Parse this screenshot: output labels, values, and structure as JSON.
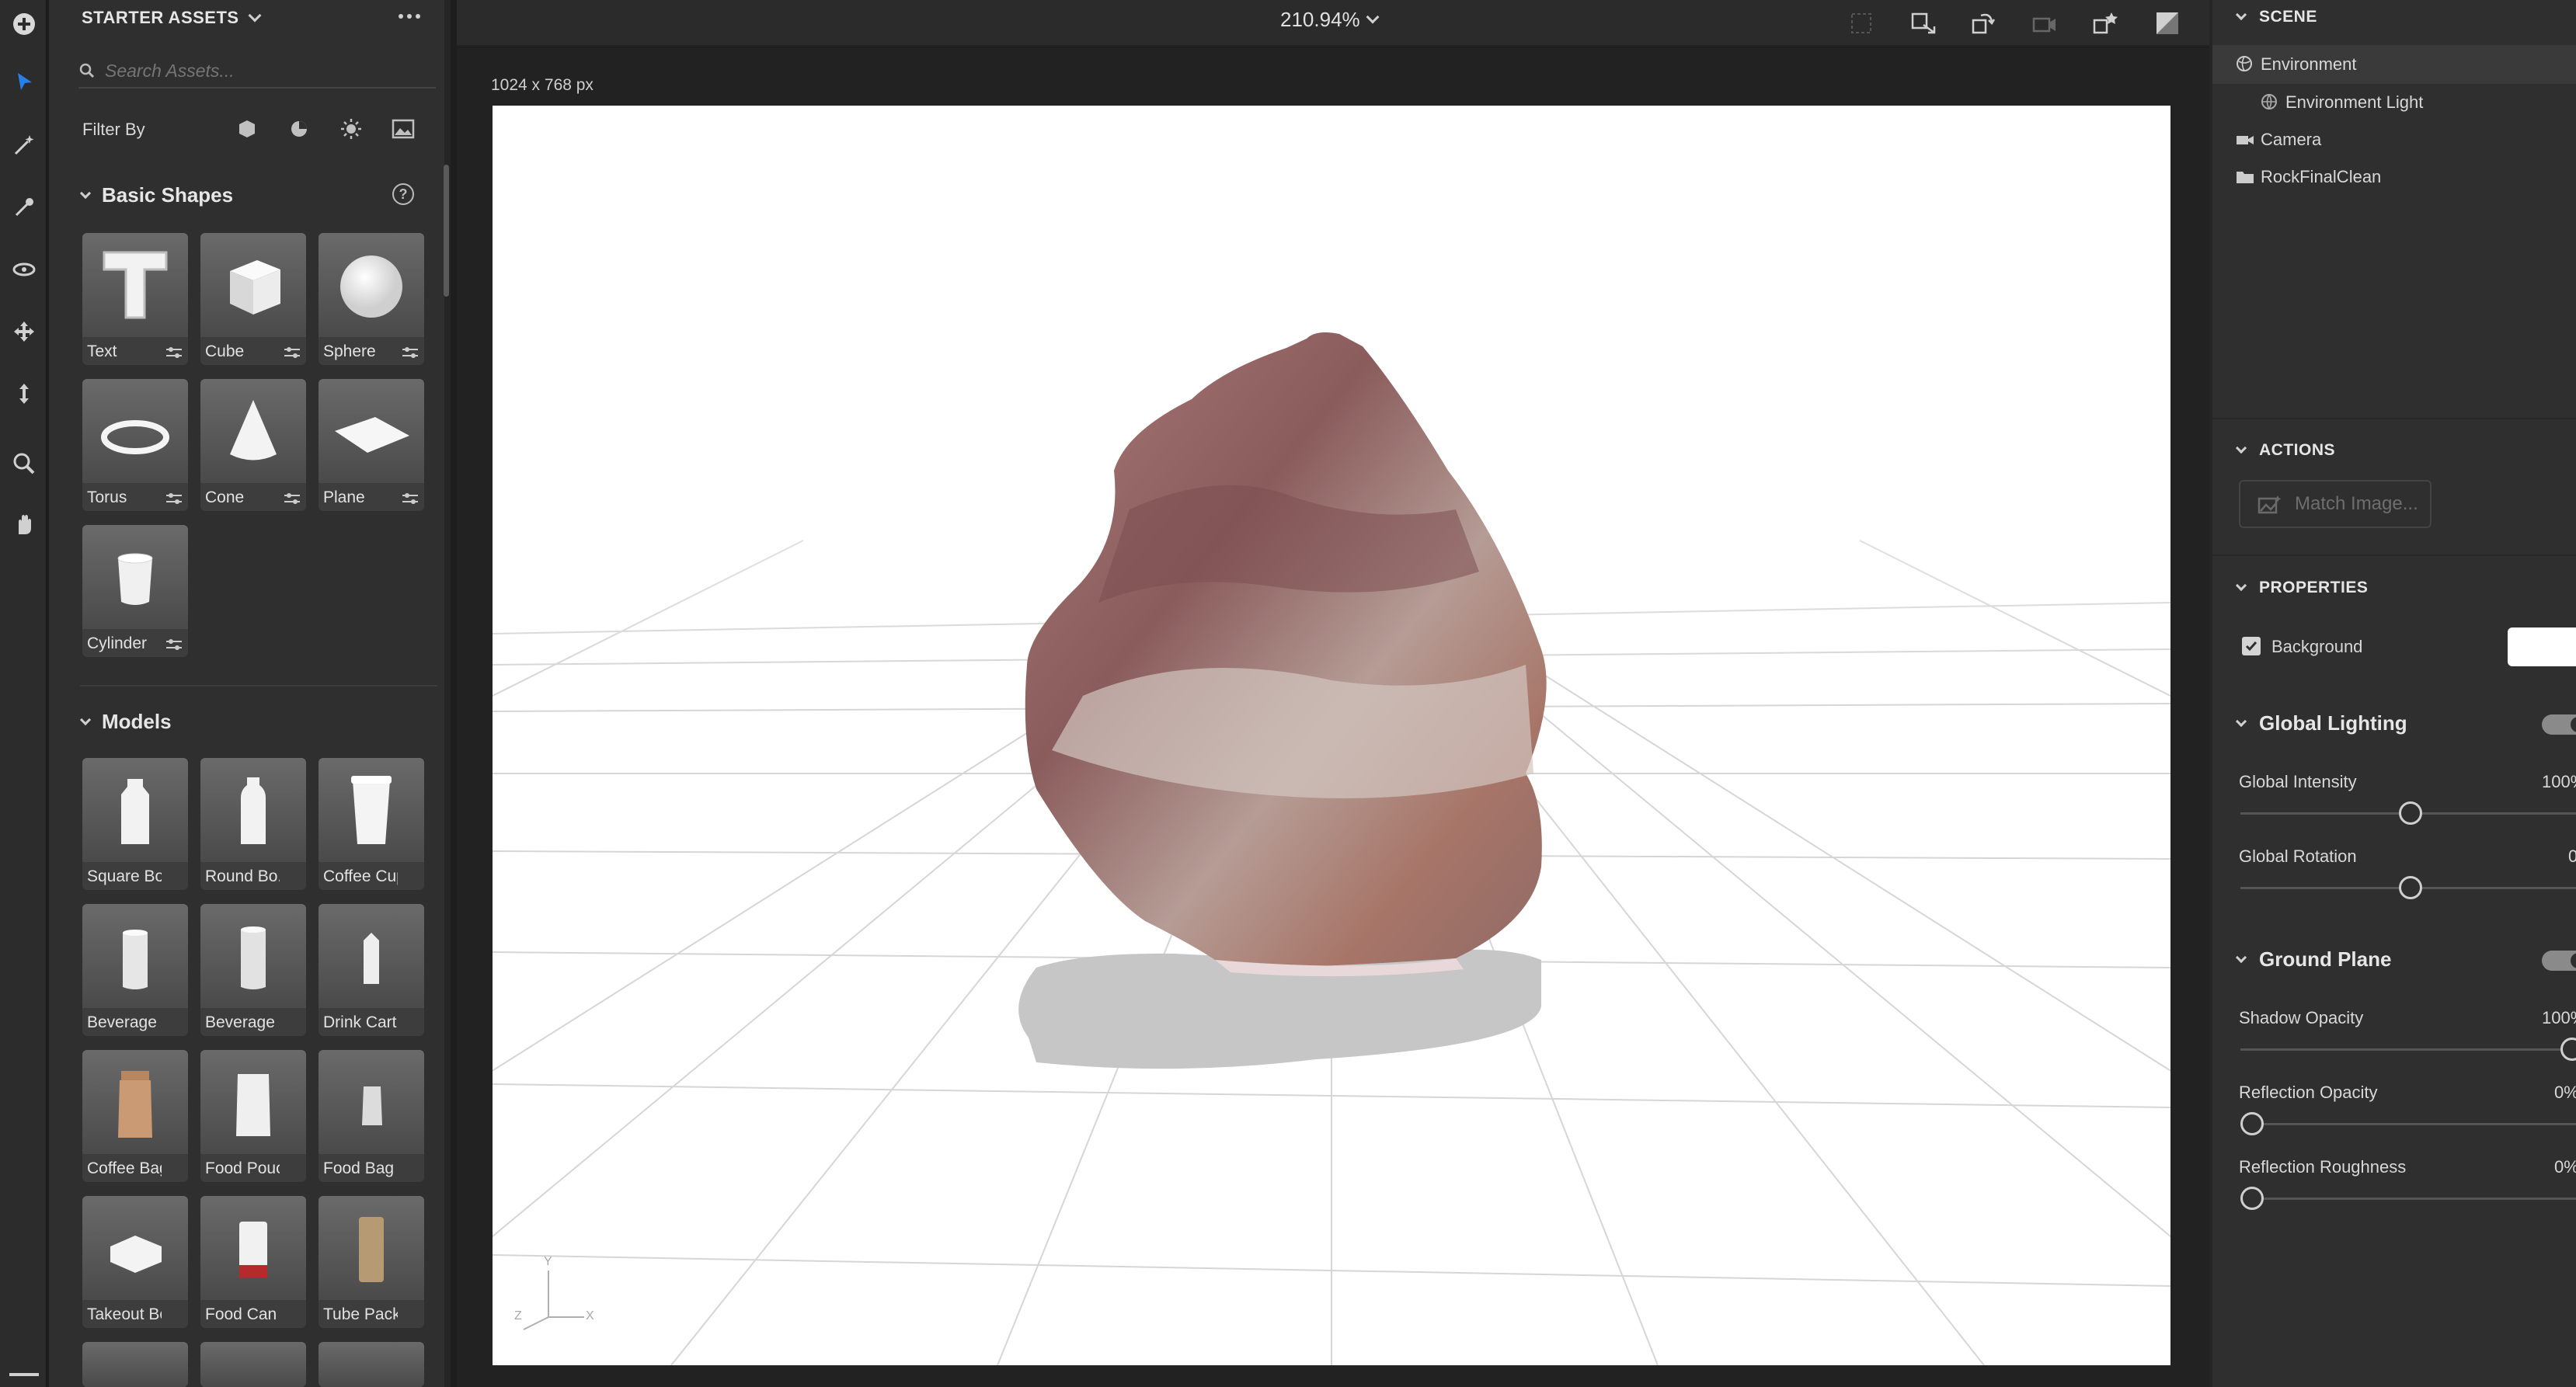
{
  "toolbar": {
    "zoom_label": "210.94%"
  },
  "assets": {
    "title": "STARTER ASSETS",
    "search_placeholder": "Search Assets...",
    "filter_label": "Filter By",
    "basic_shapes": {
      "heading": "Basic Shapes",
      "items": [
        "Text",
        "Cube",
        "Sphere",
        "Torus",
        "Cone",
        "Plane",
        "Cylinder"
      ]
    },
    "models": {
      "heading": "Models",
      "items": [
        "Square Bo...",
        "Round Bo...",
        "Coffee Cup",
        "Beverage ...",
        "Beverage ...",
        "Drink Cart...",
        "Coffee Bag",
        "Food Pouch",
        "Food Bag",
        "Takeout Box",
        "Food Can",
        "Tube Pack..."
      ]
    }
  },
  "canvas": {
    "size_label": "1024 x 768 px",
    "axis": {
      "y": "Y",
      "x": "X",
      "z": "Z"
    }
  },
  "scene": {
    "heading": "SCENE",
    "items": [
      {
        "label": "Environment",
        "icon": "globe-icon"
      },
      {
        "label": "Environment Light",
        "icon": "globe-icon"
      },
      {
        "label": "Camera",
        "icon": "camera-icon"
      },
      {
        "label": "RockFinalClean",
        "icon": "folder-icon"
      }
    ]
  },
  "actions": {
    "heading": "ACTIONS",
    "match_image": "Match Image..."
  },
  "properties": {
    "heading": "PROPERTIES",
    "background_label": "Background",
    "background_checked": true,
    "background_color": "#ffffff",
    "global_lighting": {
      "heading": "Global Lighting",
      "enabled": true,
      "intensity_label": "Global Intensity",
      "intensity_value": "100%",
      "rotation_label": "Global Rotation",
      "rotation_value": "0"
    },
    "ground_plane": {
      "heading": "Ground Plane",
      "enabled": true,
      "shadow_label": "Shadow Opacity",
      "shadow_value": "100%",
      "reflection_label": "Reflection Opacity",
      "reflection_value": "0%",
      "roughness_label": "Reflection Roughness",
      "roughness_value": "0%"
    }
  },
  "colors": {
    "accent": "#2680eb",
    "panel": "#2f2f2f",
    "rock": "#9c6b68"
  }
}
